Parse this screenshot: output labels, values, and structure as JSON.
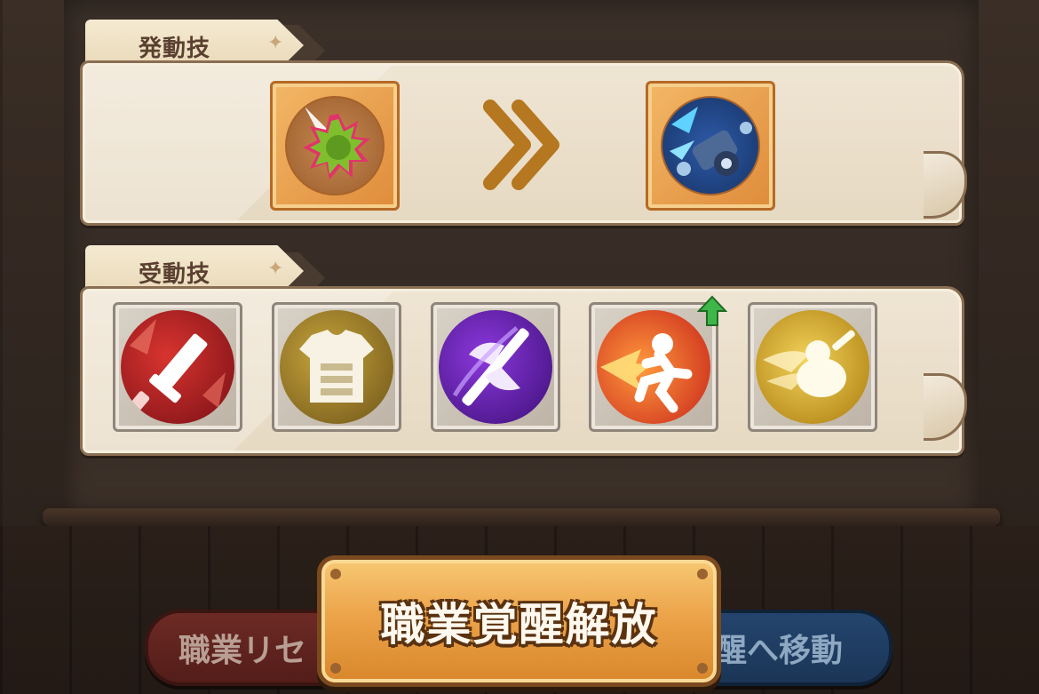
{
  "active_section": {
    "tab_label": "発動技",
    "skills": [
      {
        "icon": "spiky-green-burst-icon"
      },
      {
        "icon": "blue-cannon-icon"
      }
    ],
    "transition_icon": "double-chevron-right-icon"
  },
  "passive_section": {
    "tab_label": "受動技",
    "skills": [
      {
        "icon": "red-broken-sword-icon",
        "color": "#b3202a"
      },
      {
        "icon": "gold-armor-icon",
        "color": "#9a7a22"
      },
      {
        "icon": "purple-axe-icon",
        "color": "#6a1fb0"
      },
      {
        "icon": "red-dash-runner-icon",
        "color": "#d8381c",
        "upgrade": true
      },
      {
        "icon": "yellow-charge-icon",
        "color": "#d7a916"
      }
    ]
  },
  "buttons": {
    "left_label": "職業リセ",
    "main_label": "職業覚醒解放",
    "right_label": "醒へ移動"
  },
  "colors": {
    "main_button": "#eca44a",
    "left_button": "#6d2a24",
    "right_button": "#24456e",
    "upgrade_arrow": "#3fb64a"
  }
}
